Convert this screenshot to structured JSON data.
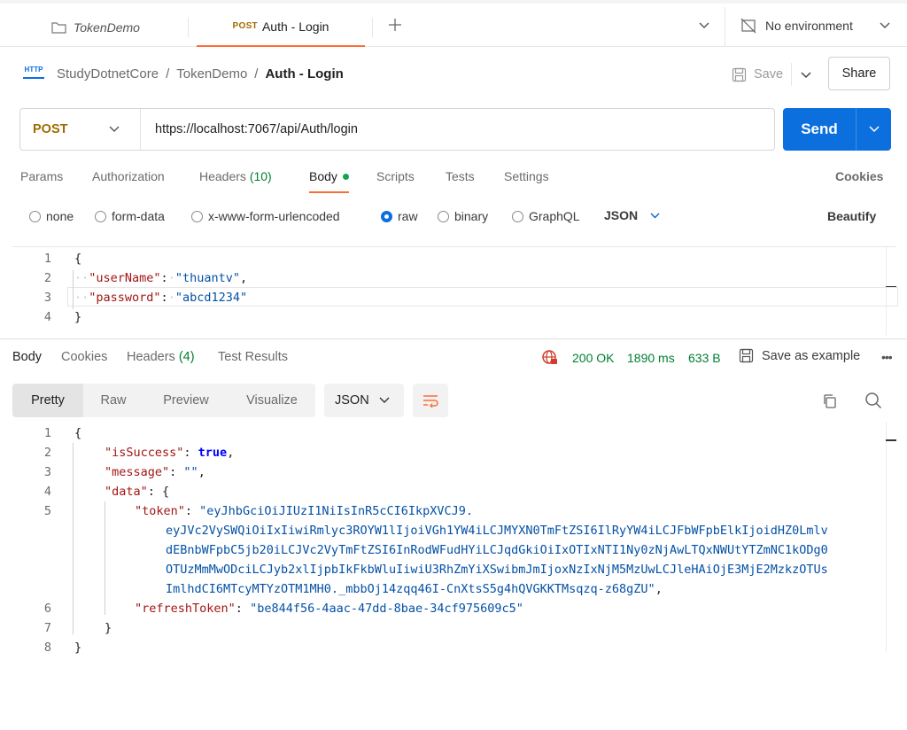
{
  "tabs": [
    {
      "label": "TokenDemo"
    },
    {
      "method": "POST",
      "label": "Auth - Login"
    }
  ],
  "environment": {
    "label": "No environment"
  },
  "breadcrumb": {
    "badge": "HTTP",
    "items": [
      "StudyDotnetCore",
      "TokenDemo"
    ],
    "current": "Auth - Login"
  },
  "actions": {
    "save": "Save",
    "share": "Share"
  },
  "request": {
    "method": "POST",
    "url": "https://localhost:7067/api/Auth/login",
    "send": "Send",
    "tabs": {
      "params": "Params",
      "authorization": "Authorization",
      "headers": "Headers",
      "headers_count": "(10)",
      "body": "Body",
      "scripts": "Scripts",
      "tests": "Tests",
      "settings": "Settings"
    },
    "cookies": "Cookies",
    "body_types": [
      "none",
      "form-data",
      "x-www-form-urlencoded",
      "raw",
      "binary",
      "GraphQL"
    ],
    "selected_body_type": "raw",
    "format": "JSON",
    "beautify": "Beautify",
    "body_lines": [
      {
        "n": "1",
        "t": "{"
      },
      {
        "n": "2",
        "key": "\"userName\"",
        "val": "\"thuantv\"",
        "end": ","
      },
      {
        "n": "3",
        "key": "\"password\"",
        "val": "\"abcd1234\"",
        "end": ""
      },
      {
        "n": "4",
        "t": "}"
      }
    ]
  },
  "response": {
    "tabs": {
      "body": "Body",
      "cookies": "Cookies",
      "headers": "Headers",
      "headers_count": "(4)",
      "test_results": "Test Results"
    },
    "status": "200 OK",
    "time": "1890 ms",
    "size": "633 B",
    "save_example": "Save as example",
    "views": [
      "Pretty",
      "Raw",
      "Preview",
      "Visualize"
    ],
    "format": "JSON",
    "lines": {
      "l1": {
        "n": "1",
        "t": "{"
      },
      "l2": {
        "n": "2",
        "key": "\"isSuccess\"",
        "val": "true",
        "end": ","
      },
      "l3": {
        "n": "3",
        "key": "\"message\"",
        "val": "\"\"",
        "end": ","
      },
      "l4": {
        "n": "4",
        "key": "\"data\"",
        "val": "{"
      },
      "l5": {
        "n": "5",
        "key": "\"token\"",
        "v1": "\"eyJhbGciOiJIUzI1NiIsInR5cCI6IkpXVCJ9.",
        "v2": "eyJVc2VySWQiOiIxIiwiRmlyc3ROYW1lIjoiVGh1YW4iLCJMYXN0TmFtZSI6IlRyYW4iLCJFbWFpbElkIjoidHZ0Lmlv",
        "v3": "dEBnbWFpbC5jb20iLCJVc2VyTmFtZSI6InRodWFudHYiLCJqdGkiOiIxOTIxNTI1Ny0zNjAwLTQxNWUtYTZmNC1kODg0",
        "v4": "OTUzMmMwODciLCJyb2xlIjpbIkFkbWluIiwiU3RhZmYiXSwibmJmIjoxNzIxNjM5MzUwLCJleHAiOjE3MjE2MzkzOTUs",
        "v5": "ImlhdCI6MTcyMTYzOTM1MH0._mbbOj14zqq46I-CnXtsS5g4hQVGKKTMsqzq-z68gZU\"",
        "end": ","
      },
      "l6": {
        "n": "6",
        "key": "\"refreshToken\"",
        "val": "\"be844f56-4aac-47dd-8bae-34cf975609c5\""
      },
      "l7": {
        "n": "7",
        "t": "}"
      },
      "l8": {
        "n": "8",
        "t": "}"
      }
    }
  },
  "colors": {
    "accent": "#ff6c37",
    "send": "#0c6fde",
    "link": "#0265d2",
    "status_ok": "#007f31",
    "method": "#a06b00"
  }
}
